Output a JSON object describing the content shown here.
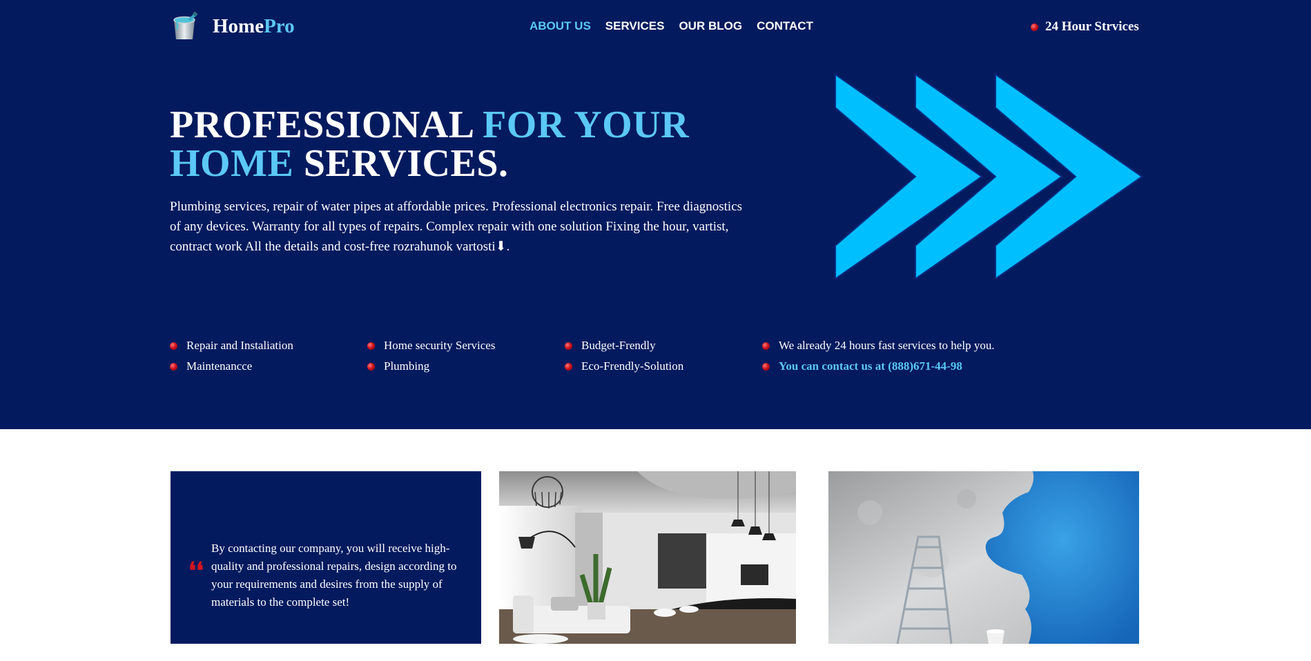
{
  "header": {
    "brand_home": "Home",
    "brand_pro": "Pro",
    "logo_icon": "paint-bucket-icon",
    "nav": [
      {
        "label": "ABOUT US",
        "active": true
      },
      {
        "label": "SERVICES",
        "active": false
      },
      {
        "label": "OUR BLOG",
        "active": false
      },
      {
        "label": "CONTACT",
        "active": false
      }
    ],
    "hotline": "24 Hour Strvices"
  },
  "hero": {
    "headline_1": "PROFESSIONAL ",
    "headline_2": "FOR YOUR",
    "headline_3": "HOME",
    "headline_4": " SERVICES.",
    "intro": "Plumbing services, repair of water pipes at affordable prices. Professional electronics repair. Free diagnostics of any devices. Warranty for all types of repairs. Complex repair with one solution Fixing the hour, vartist, contract work All the details and cost-free rozrahunok vartosti⬇.",
    "graphic": "triple-chevron-arrows"
  },
  "features": {
    "col1": [
      "Repair and Instaliation",
      "Maintenancce"
    ],
    "col2": [
      "Home security Services",
      "Plumbing"
    ],
    "col3": [
      "Budget-Frendly",
      "Eco-Frendly-Solution"
    ],
    "col4_text": "We already 24 hours fast services to help you.",
    "col4_contact": "You can contact us at (888)671-44-98"
  },
  "cards": {
    "quote_mark": "❛❛",
    "quote_text": "By contacting our company, you will receive high-quality and professional repairs, design according to your requirements and desires from the supply of materials to the complete set!",
    "image_1": "modern-interior-photo",
    "image_2": "painting-wall-blue-photo"
  },
  "colors": {
    "navy": "#031a5e",
    "accent": "#5bc8f5",
    "arrow": "#00bfff",
    "bullet": "#d2141f"
  }
}
